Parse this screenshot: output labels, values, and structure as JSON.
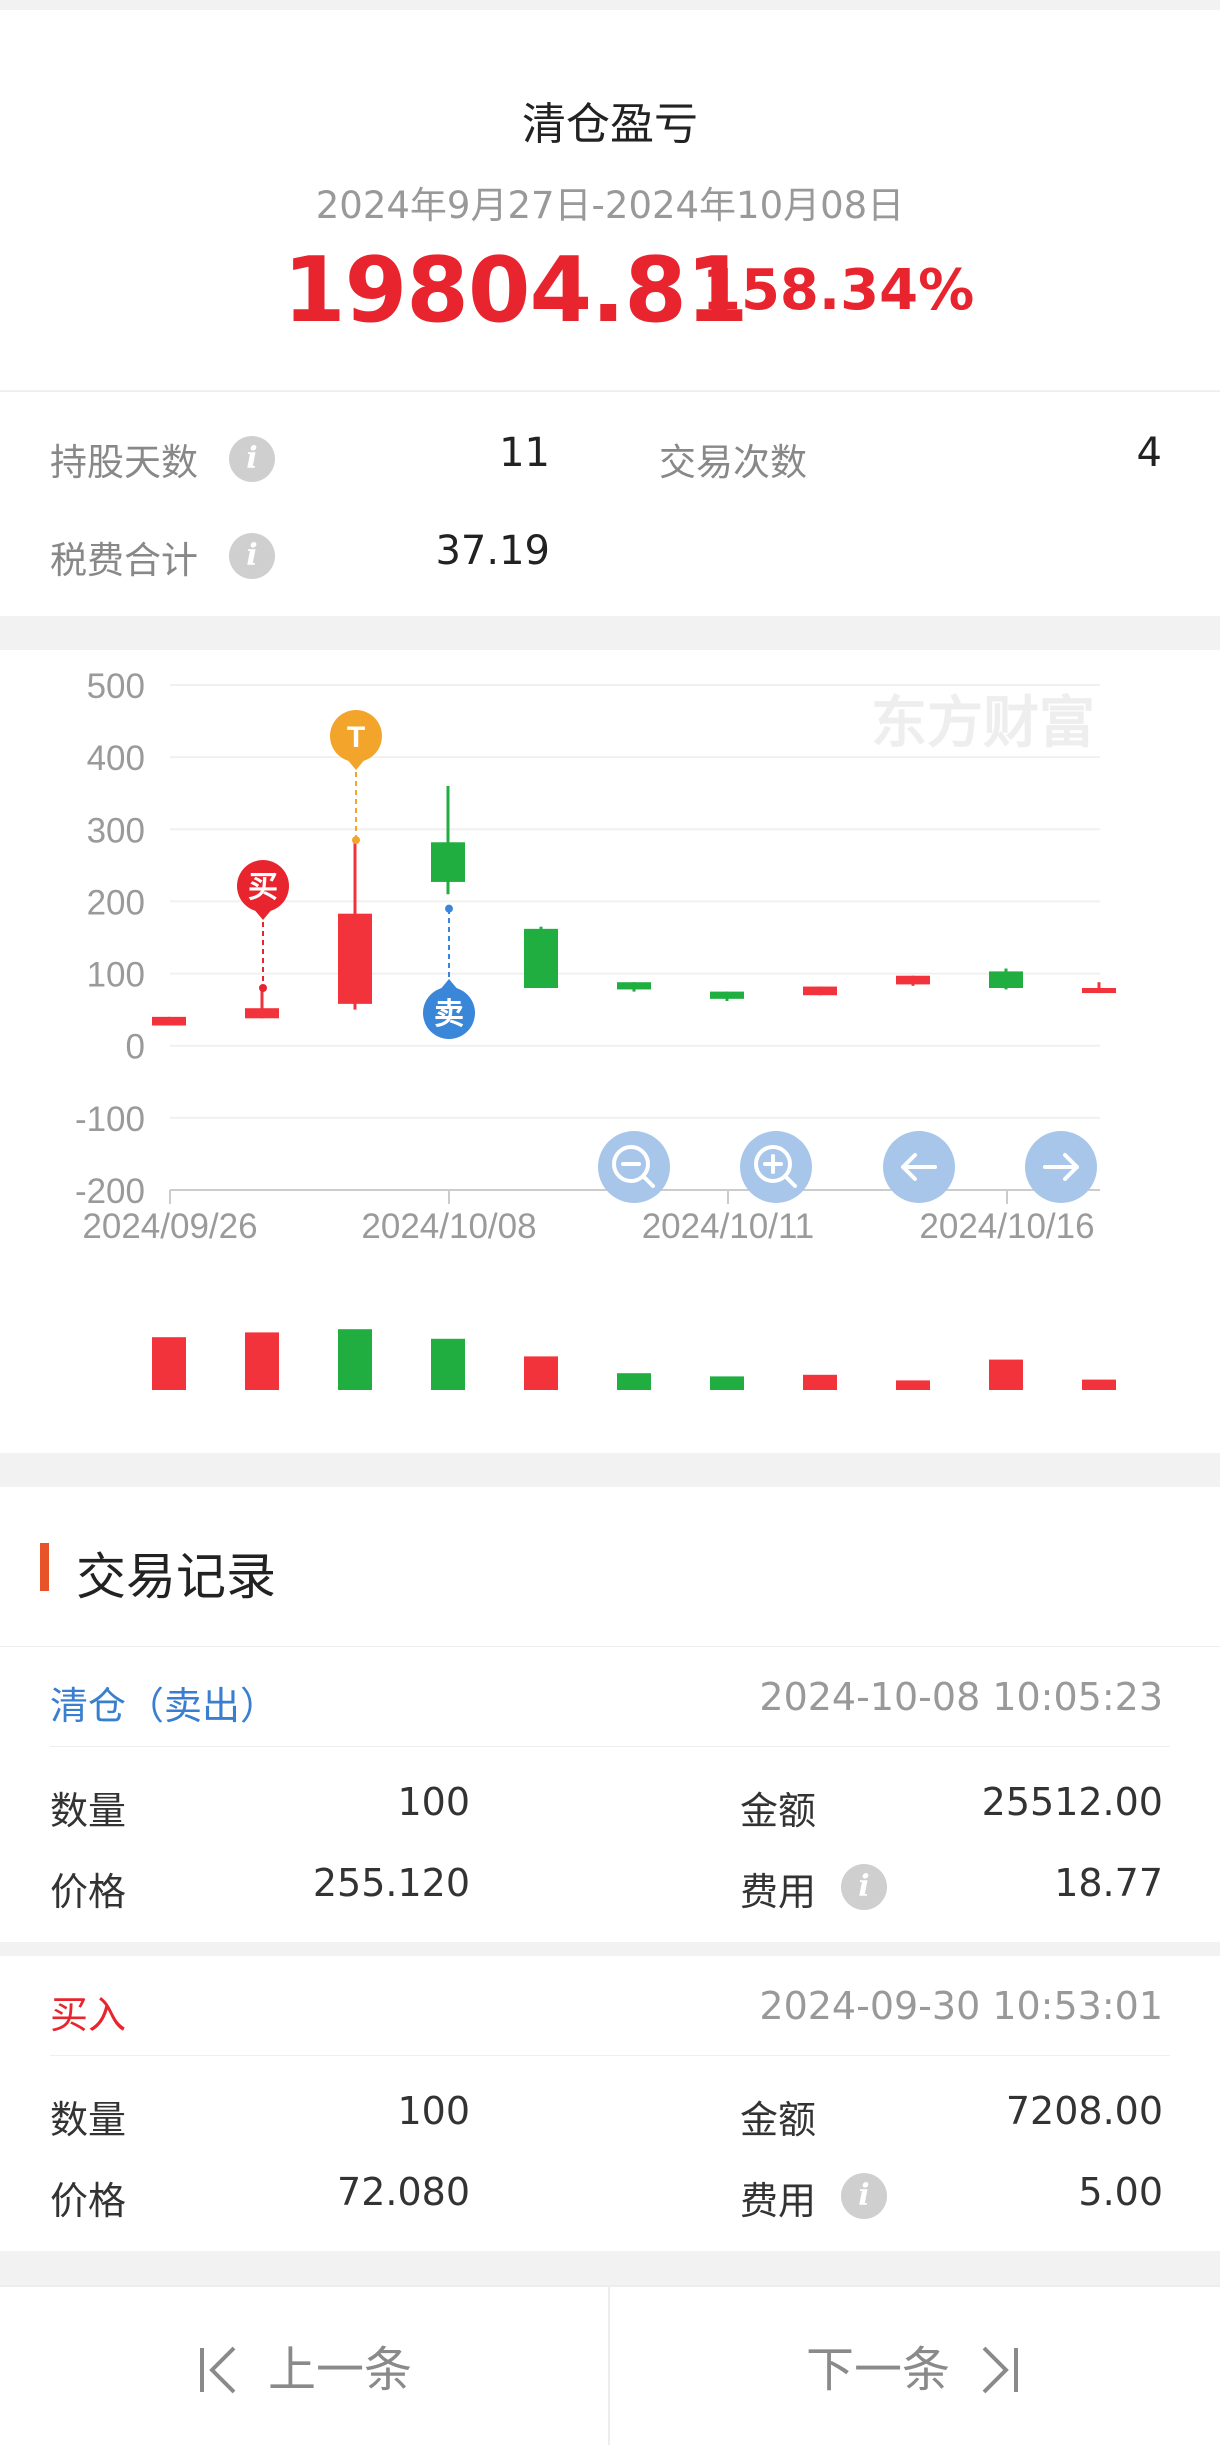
{
  "summary": {
    "title": "清仓盈亏",
    "date_range": "2024年9月27日-2024年10月08日",
    "profit_amount": "19804.81",
    "profit_percent": "158.34%"
  },
  "stats": {
    "holding_days_label": "持股天数",
    "holding_days_value": "11",
    "trade_count_label": "交易次数",
    "trade_count_value": "4",
    "fees_label": "税费合计",
    "fees_value": "37.19",
    "info_icon": "i"
  },
  "chart": {
    "watermark": "东方财富",
    "marker_buy": "买",
    "marker_sell": "卖",
    "marker_t": "T",
    "colors": {
      "up": "#f2333b",
      "down": "#1fae3f",
      "buy": "#e8252e",
      "sell": "#3a86d8",
      "t": "#f3a52b"
    },
    "controls": [
      "zoom-out",
      "zoom-in",
      "pan-left",
      "pan-right"
    ]
  },
  "chart_data": {
    "type": "candlestick",
    "ylim": [
      -200,
      500
    ],
    "yticks": [
      "500",
      "400",
      "300",
      "200",
      "100",
      "0",
      "-100",
      "-200"
    ],
    "yticks_num": [
      500,
      400,
      300,
      200,
      100,
      0,
      -100,
      -200
    ],
    "xtick_labels": [
      "2024/09/26",
      "2024/10/08",
      "2024/10/11",
      "2024/10/16"
    ],
    "xtick_index": [
      0,
      3,
      6,
      9
    ],
    "candles": [
      {
        "open": 28,
        "close": 40,
        "high": 40,
        "low": 28,
        "dir": "up"
      },
      {
        "open": 38,
        "close": 52,
        "high": 80,
        "low": 38,
        "dir": "up"
      },
      {
        "open": 58,
        "close": 183,
        "high": 285,
        "low": 50,
        "dir": "up"
      },
      {
        "open": 282,
        "close": 227,
        "high": 360,
        "low": 210,
        "dir": "down"
      },
      {
        "open": 162,
        "close": 80,
        "high": 165,
        "low": 80,
        "dir": "down"
      },
      {
        "open": 88,
        "close": 78,
        "high": 88,
        "low": 75,
        "dir": "down"
      },
      {
        "open": 75,
        "close": 65,
        "high": 75,
        "low": 62,
        "dir": "down"
      },
      {
        "open": 70,
        "close": 82,
        "high": 82,
        "low": 70,
        "dir": "up"
      },
      {
        "open": 85,
        "close": 97,
        "high": 97,
        "low": 83,
        "dir": "up"
      },
      {
        "open": 103,
        "close": 80,
        "high": 107,
        "low": 78,
        "dir": "down"
      },
      {
        "open": 73,
        "close": 80,
        "high": 88,
        "low": 73,
        "dir": "up"
      }
    ],
    "volume": [
      {
        "v": 0.66,
        "dir": "up"
      },
      {
        "v": 0.72,
        "dir": "up"
      },
      {
        "v": 0.76,
        "dir": "down"
      },
      {
        "v": 0.64,
        "dir": "down"
      },
      {
        "v": 0.42,
        "dir": "up"
      },
      {
        "v": 0.21,
        "dir": "down"
      },
      {
        "v": 0.17,
        "dir": "down"
      },
      {
        "v": 0.19,
        "dir": "up"
      },
      {
        "v": 0.12,
        "dir": "up"
      },
      {
        "v": 0.38,
        "dir": "up"
      },
      {
        "v": 0.13,
        "dir": "up"
      }
    ],
    "markers": [
      {
        "kind": "buy",
        "index": 1,
        "price": 80
      },
      {
        "kind": "t",
        "index": 2,
        "price": 285
      },
      {
        "kind": "sell",
        "index": 3,
        "price": 190
      }
    ]
  },
  "records": {
    "title": "交易记录",
    "items": [
      {
        "type": "清仓（卖出）",
        "type_color": "#3a7fcf",
        "time": "2024-10-08 10:05:23",
        "qty_label": "数量",
        "qty": "100",
        "amount_label": "金额",
        "amount": "25512.00",
        "price_label": "价格",
        "price": "255.120",
        "fee_label": "费用",
        "fee": "18.77"
      },
      {
        "type": "买入",
        "type_color": "#e8252e",
        "time": "2024-09-30 10:53:01",
        "qty_label": "数量",
        "qty": "100",
        "amount_label": "金额",
        "amount": "7208.00",
        "price_label": "价格",
        "price": "72.080",
        "fee_label": "费用",
        "fee": "5.00"
      }
    ]
  },
  "footer": {
    "prev_label": "上一条",
    "next_label": "下一条"
  }
}
